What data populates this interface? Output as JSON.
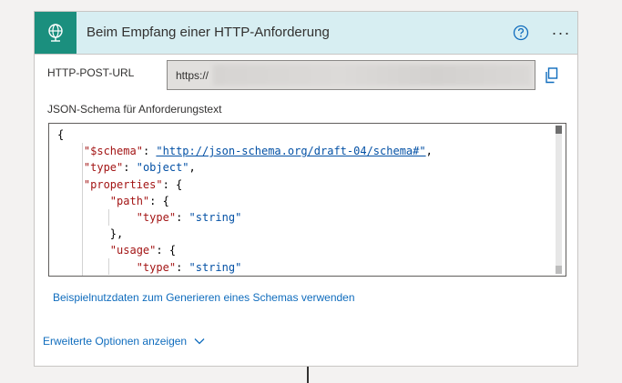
{
  "header": {
    "title": "Beim Empfang einer HTTP-Anforderung",
    "trigger_icon": "globe-request-icon",
    "help_icon": "question-circle-icon",
    "more_icon": "ellipsis-icon",
    "more_label": "···",
    "accent_color": "#1b8f7e",
    "header_bg": "#d7eef2"
  },
  "url": {
    "label": "HTTP-POST-URL",
    "value_visible": "https://",
    "copy_icon": "copy-icon"
  },
  "schema": {
    "label": "JSON-Schema für Anforderungstext",
    "lines": [
      [
        {
          "t": "{",
          "c": "p"
        }
      ],
      [
        {
          "t": "    ",
          "c": "p"
        },
        {
          "t": "\"$schema\"",
          "c": "k"
        },
        {
          "t": ": ",
          "c": "p"
        },
        {
          "t": "\"http://json-schema.org/draft-04/schema#\"",
          "c": "u"
        },
        {
          "t": ",",
          "c": "p"
        }
      ],
      [
        {
          "t": "    ",
          "c": "p"
        },
        {
          "t": "\"type\"",
          "c": "k"
        },
        {
          "t": ": ",
          "c": "p"
        },
        {
          "t": "\"object\"",
          "c": "s"
        },
        {
          "t": ",",
          "c": "p"
        }
      ],
      [
        {
          "t": "    ",
          "c": "p"
        },
        {
          "t": "\"properties\"",
          "c": "k"
        },
        {
          "t": ": {",
          "c": "p"
        }
      ],
      [
        {
          "t": "        ",
          "c": "p"
        },
        {
          "t": "\"path\"",
          "c": "k"
        },
        {
          "t": ": {",
          "c": "p"
        }
      ],
      [
        {
          "t": "            ",
          "c": "p"
        },
        {
          "t": "\"type\"",
          "c": "k"
        },
        {
          "t": ": ",
          "c": "p"
        },
        {
          "t": "\"string\"",
          "c": "s"
        }
      ],
      [
        {
          "t": "        },",
          "c": "p"
        }
      ],
      [
        {
          "t": "        ",
          "c": "p"
        },
        {
          "t": "\"usage\"",
          "c": "k"
        },
        {
          "t": ": {",
          "c": "p"
        }
      ],
      [
        {
          "t": "            ",
          "c": "p"
        },
        {
          "t": "\"type\"",
          "c": "k"
        },
        {
          "t": ": ",
          "c": "p"
        },
        {
          "t": "\"string\"",
          "c": "s"
        }
      ],
      [
        {
          "t": "        }",
          "c": "p"
        }
      ]
    ]
  },
  "links": {
    "sample_payload": "Beispielnutzdaten zum Generieren eines Schemas verwenden",
    "advanced_options": "Erweiterte Optionen anzeigen",
    "chevron_icon": "chevron-down-icon",
    "link_color": "#0f6cbd"
  }
}
